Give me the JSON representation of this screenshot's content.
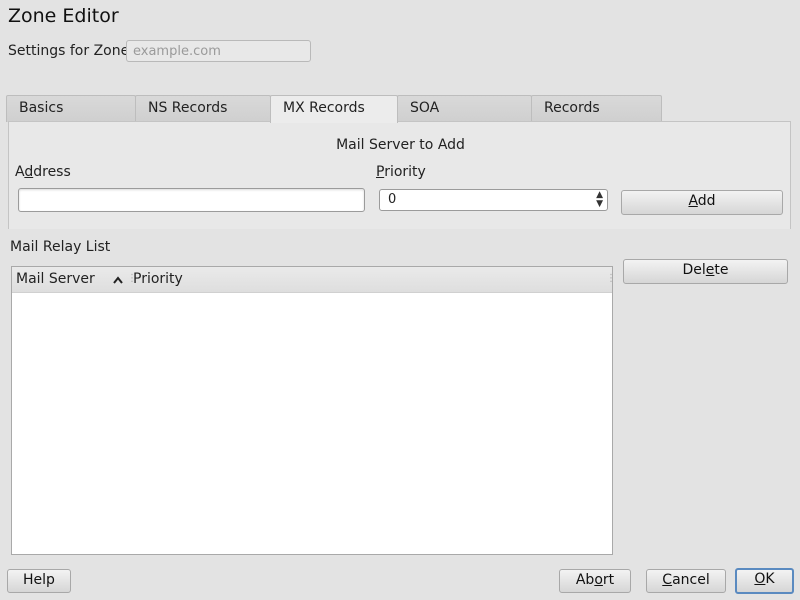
{
  "window": {
    "title": "Zone Editor"
  },
  "zone": {
    "label": "Settings for Zone",
    "value": "example.com"
  },
  "tabs": [
    {
      "label": "Basics"
    },
    {
      "label": "NS Records"
    },
    {
      "label": "MX Records",
      "active": true
    },
    {
      "label": "SOA"
    },
    {
      "label": "Records"
    }
  ],
  "mail_server_group": {
    "title": "Mail Server to Add",
    "address_label_pre": "A",
    "address_label_mn": "d",
    "address_label_post": "dress",
    "address_value": "",
    "priority_label_mn": "P",
    "priority_label_post": "riority",
    "priority_value": "0",
    "add_pre": "",
    "add_mn": "A",
    "add_post": "dd"
  },
  "relay_list": {
    "label": "Mail Relay List",
    "columns": [
      "Mail Server",
      "Priority"
    ],
    "sort_icon": "caret-up-icon",
    "rows": []
  },
  "delete_button": {
    "pre": "Del",
    "mn": "e",
    "post": "te"
  },
  "footer": {
    "help": "Help",
    "abort_pre": "Ab",
    "abort_mn": "o",
    "abort_post": "rt",
    "cancel_pre": "",
    "cancel_mn": "C",
    "cancel_post": "ancel",
    "ok_pre": "",
    "ok_mn": "O",
    "ok_post": "K"
  },
  "colors": {
    "background": "#e3e3e3",
    "default_button_border": "#5a8ac0"
  }
}
